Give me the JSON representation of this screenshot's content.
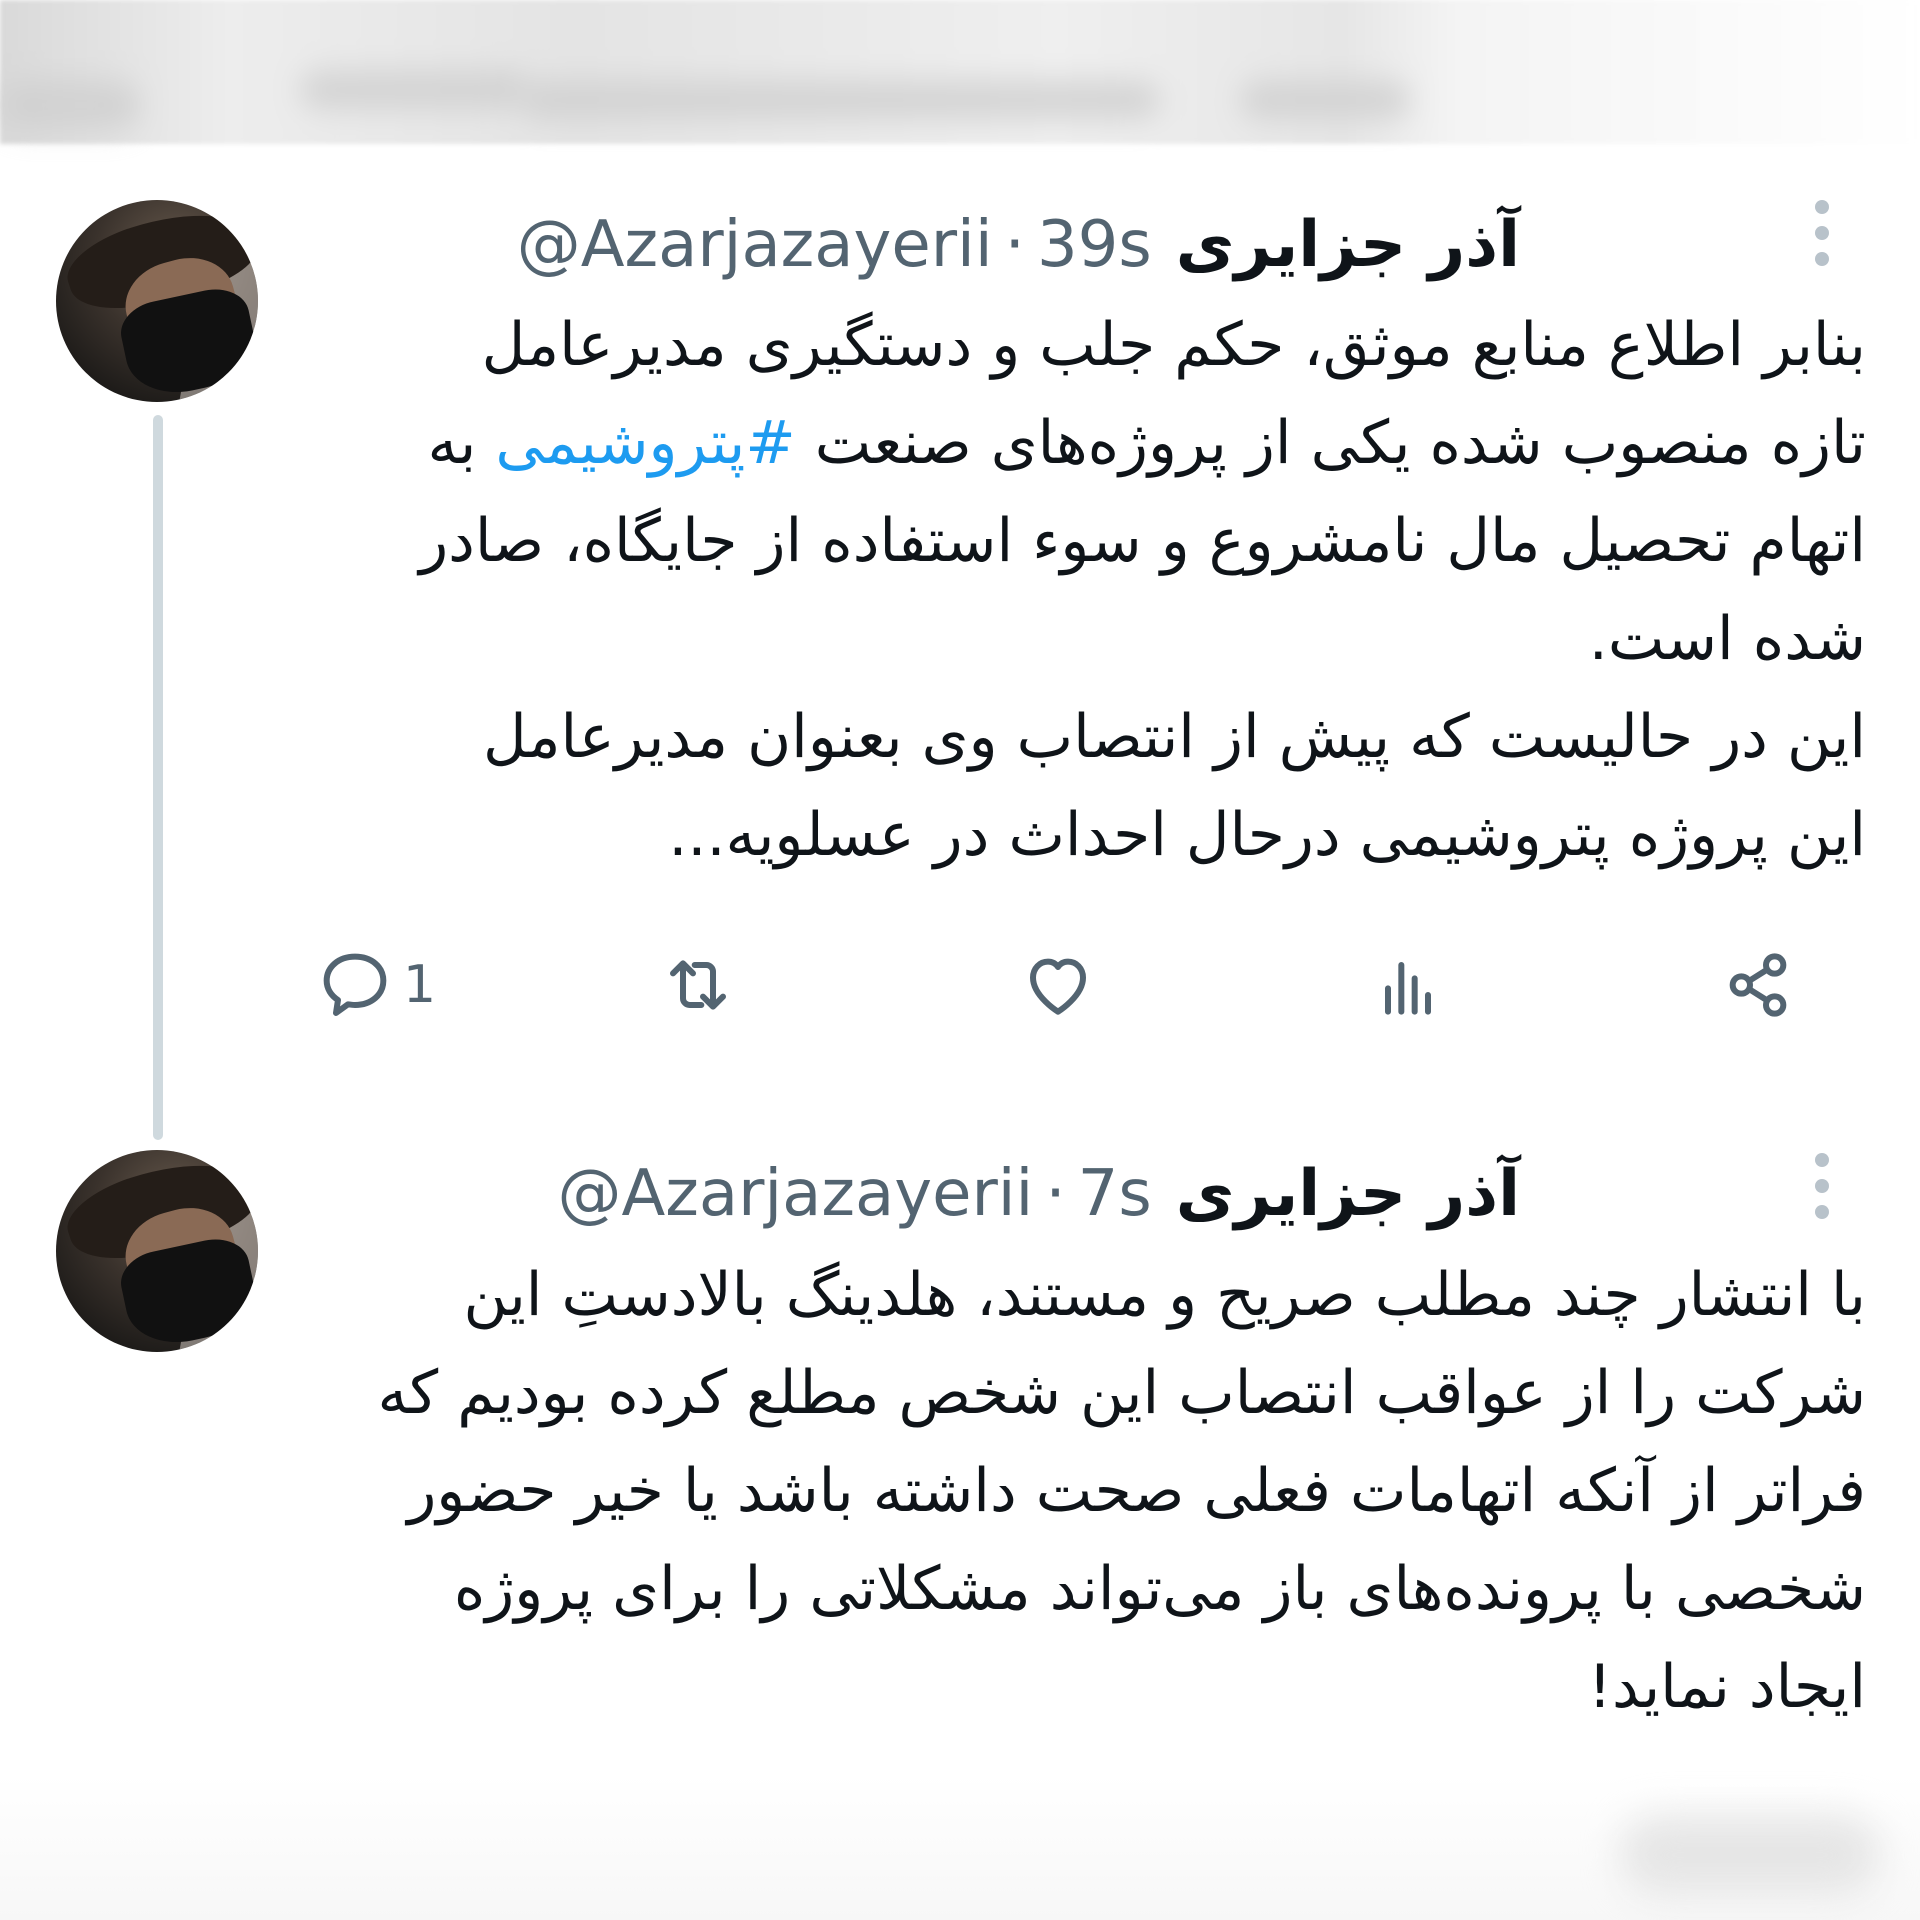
{
  "tweets": [
    {
      "display_name": "آذر جزایری",
      "handle": "@Azarjazayerii",
      "separator": "·",
      "time": "39s",
      "text_before": "بنابر اطلاع منابع موثق، حکم جلب و دستگیری مدیرعامل\nتازه منصوب شده یکی از پروژه‌های صنعت ",
      "hashtag": "#پتروشیمی",
      "text_after": " به\nاتهام تحصیل مال نامشروع و سوء استفاده از جایگاه، صادر\nشده است.\nاین در حالیست که پیش از انتصاب وی بعنوان مدیرعامل\nاین پروژه پتروشیمی درحال احداث در عسلویه...",
      "actions": {
        "reply_count": "1",
        "reply_icon": "speech-bubble-icon",
        "retweet_icon": "retweet-icon",
        "like_icon": "heart-icon",
        "views_icon": "bar-chart-icon",
        "share_icon": "share-icon"
      }
    },
    {
      "display_name": "آذر جزایری",
      "handle": "@Azarjazayerii",
      "separator": "·",
      "time": "7s",
      "text": "با انتشار چند مطلب صریح و مستند، هلدینگ بالادستِ این\nشرکت را از عواقب انتصاب این شخص مطلع کرده بودیم که\nفراتر از آنکه اتهامات فعلی صحت داشته باشد یا خیر حضور\nشخصی با پرونده‌های باز می‌تواند مشکلاتی را برای پروژه\nایجاد نماید!"
    }
  ],
  "colors": {
    "text": "#0f1419",
    "secondary": "#536471",
    "hashtag": "#1d9bf0",
    "thread_line": "#cfd9de"
  }
}
